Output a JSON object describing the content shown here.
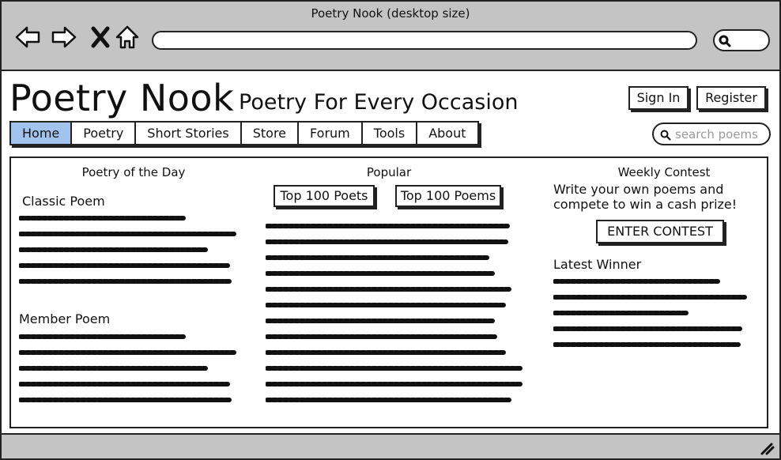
{
  "window": {
    "title": "Poetry Nook (desktop size)"
  },
  "browser": {
    "back_icon": "arrow-left-icon",
    "forward_icon": "arrow-right-icon",
    "stop_icon": "close-icon",
    "home_icon": "home-icon",
    "search_icon": "search-icon",
    "url": ""
  },
  "header": {
    "title": "Poetry Nook",
    "tagline": "Poetry For Every Occasion",
    "sign_in": "Sign In",
    "register": "Register"
  },
  "nav": {
    "tabs": [
      {
        "label": "Home",
        "active": true
      },
      {
        "label": "Poetry",
        "active": false
      },
      {
        "label": "Short Stories",
        "active": false
      },
      {
        "label": "Store",
        "active": false
      },
      {
        "label": "Forum",
        "active": false
      },
      {
        "label": "Tools",
        "active": false
      },
      {
        "label": "About",
        "active": false
      }
    ],
    "search_placeholder": "search poems"
  },
  "poetry_of_day": {
    "heading": "Poetry of the Day",
    "classic_label": "Classic Poem",
    "member_label": "Member Poem"
  },
  "popular": {
    "heading": "Popular",
    "top_poets": "Top 100 Poets",
    "top_poems": "Top 100 Poems"
  },
  "contest": {
    "heading": "Weekly Contest",
    "description": "Write your own poems and compete to win a cash prize!",
    "enter_button": "ENTER CONTEST",
    "winner_label": "Latest Winner"
  },
  "colors": {
    "chrome": "#c4c4c4",
    "active_tab": "#a3c3ef",
    "ink": "#111111"
  }
}
